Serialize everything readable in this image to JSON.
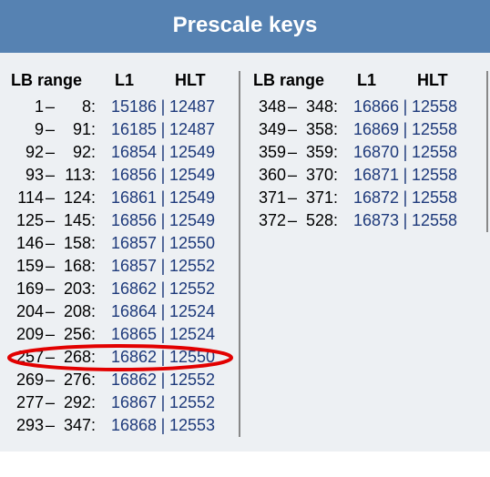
{
  "title": "Prescale keys",
  "headers": {
    "lb_range": "LB range",
    "l1": "L1",
    "hlt": "HLT"
  },
  "left_column": [
    {
      "from": "1",
      "to": "8",
      "l1": "15186",
      "hlt": "12487"
    },
    {
      "from": "9",
      "to": "91",
      "l1": "16185",
      "hlt": "12487"
    },
    {
      "from": "92",
      "to": "92",
      "l1": "16854",
      "hlt": "12549"
    },
    {
      "from": "93",
      "to": "113",
      "l1": "16856",
      "hlt": "12549"
    },
    {
      "from": "114",
      "to": "124",
      "l1": "16861",
      "hlt": "12549"
    },
    {
      "from": "125",
      "to": "145",
      "l1": "16856",
      "hlt": "12549"
    },
    {
      "from": "146",
      "to": "158",
      "l1": "16857",
      "hlt": "12550"
    },
    {
      "from": "159",
      "to": "168",
      "l1": "16857",
      "hlt": "12552"
    },
    {
      "from": "169",
      "to": "203",
      "l1": "16862",
      "hlt": "12552"
    },
    {
      "from": "204",
      "to": "208",
      "l1": "16864",
      "hlt": "12524"
    },
    {
      "from": "209",
      "to": "256",
      "l1": "16865",
      "hlt": "12524"
    },
    {
      "from": "257",
      "to": "268",
      "l1": "16862",
      "hlt": "12550",
      "circled": true
    },
    {
      "from": "269",
      "to": "276",
      "l1": "16862",
      "hlt": "12552"
    },
    {
      "from": "277",
      "to": "292",
      "l1": "16867",
      "hlt": "12552"
    },
    {
      "from": "293",
      "to": "347",
      "l1": "16868",
      "hlt": "12553"
    }
  ],
  "right_column": [
    {
      "from": "348",
      "to": "348",
      "l1": "16866",
      "hlt": "12558"
    },
    {
      "from": "349",
      "to": "358",
      "l1": "16869",
      "hlt": "12558"
    },
    {
      "from": "359",
      "to": "359",
      "l1": "16870",
      "hlt": "12558"
    },
    {
      "from": "360",
      "to": "370",
      "l1": "16871",
      "hlt": "12558"
    },
    {
      "from": "371",
      "to": "371",
      "l1": "16872",
      "hlt": "12558"
    },
    {
      "from": "372",
      "to": "528",
      "l1": "16873",
      "hlt": "12558"
    }
  ],
  "dash": "–",
  "sep": "|",
  "colon": ":"
}
